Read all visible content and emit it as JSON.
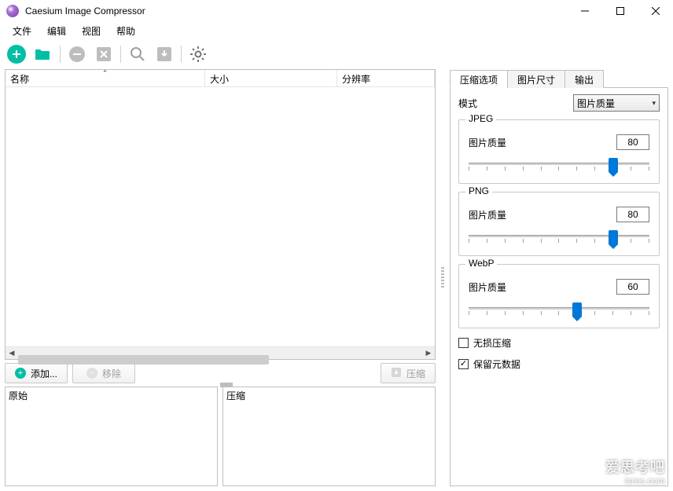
{
  "title": "Caesium Image Compressor",
  "menu": {
    "file": "文件",
    "edit": "编辑",
    "view": "视图",
    "help": "帮助"
  },
  "columns": {
    "name": "名称",
    "size": "大小",
    "resolution": "分辨率"
  },
  "actions": {
    "add": "添加...",
    "remove": "移除",
    "compress": "压缩"
  },
  "preview": {
    "original": "原始",
    "compressed": "压缩"
  },
  "tabs": {
    "compression": "压缩选项",
    "image_size": "图片尺寸",
    "output": "输出"
  },
  "mode_label": "模式",
  "mode_value": "图片质量",
  "quality_label": "图片质量",
  "groups": {
    "jpeg": {
      "title": "JPEG",
      "value": "80"
    },
    "png": {
      "title": "PNG",
      "value": "80"
    },
    "webp": {
      "title": "WebP",
      "value": "60"
    }
  },
  "checks": {
    "lossless": "无损压缩",
    "keep_metadata": "保留元数据"
  },
  "watermark": {
    "line1": "爱思考吧",
    "line2": "isres.com"
  }
}
